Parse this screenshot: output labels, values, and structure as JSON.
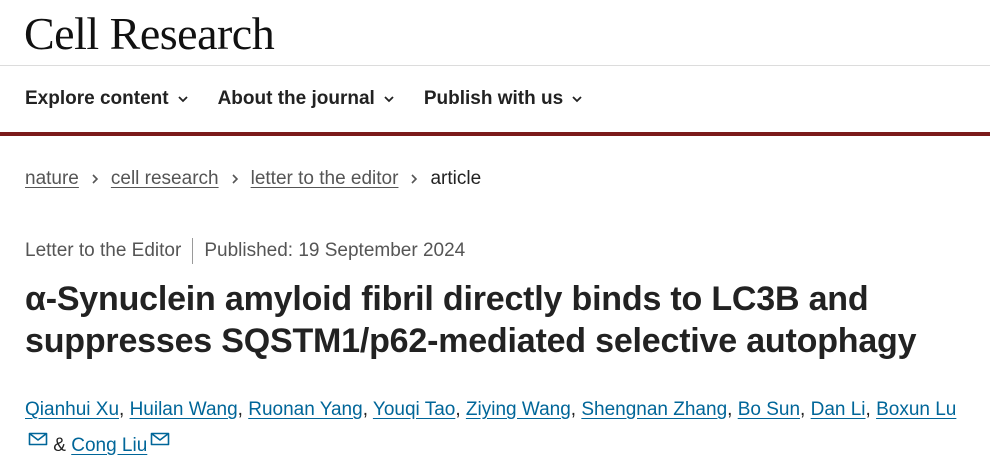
{
  "header": {
    "brand": "Cell Research"
  },
  "nav": {
    "items": [
      {
        "label": "Explore content"
      },
      {
        "label": "About the journal"
      },
      {
        "label": "Publish with us"
      }
    ]
  },
  "breadcrumb": {
    "items": [
      "nature",
      "cell research",
      "letter to the editor"
    ],
    "current": "article"
  },
  "article": {
    "type": "Letter to the Editor",
    "published": "Published: 19 September 2024",
    "title_line1": "α-Synuclein amyloid fibril directly binds to LC3B and",
    "title_line2": "suppresses SQSTM1/p62-mediated selective autophagy",
    "authors": [
      "Qianhui Xu",
      "Huilan Wang",
      "Ruonan Yang",
      "Youqi Tao",
      "Ziying Wang",
      "Shengnan Zhang",
      "Bo Sun",
      "Dan Li",
      "Boxun Lu",
      "Cong Liu"
    ],
    "author_separator": ", ",
    "author_last_separator": " & "
  },
  "colors": {
    "accent_rule": "#7b1a1a",
    "link": "#006699"
  }
}
